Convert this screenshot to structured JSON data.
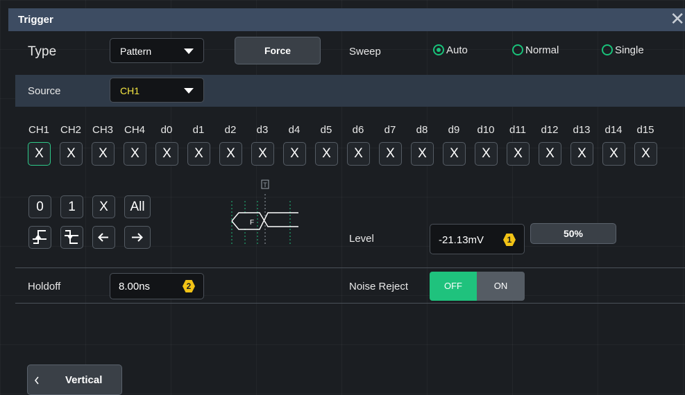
{
  "dialog": {
    "title": "Trigger"
  },
  "type": {
    "label": "Type",
    "value": "Pattern"
  },
  "force_label": "Force",
  "sweep": {
    "label": "Sweep",
    "options": [
      "Auto",
      "Normal",
      "Single"
    ],
    "selected": "Auto"
  },
  "source": {
    "label": "Source",
    "value": "CH1"
  },
  "channels": {
    "labels": [
      "CH1",
      "CH2",
      "CH3",
      "CH4",
      "d0",
      "d1",
      "d2",
      "d3",
      "d4",
      "d5",
      "d6",
      "d7",
      "d8",
      "d9",
      "d10",
      "d11",
      "d12",
      "d13",
      "d14",
      "d15"
    ],
    "values": [
      "X",
      "X",
      "X",
      "X",
      "X",
      "X",
      "X",
      "X",
      "X",
      "X",
      "X",
      "X",
      "X",
      "X",
      "X",
      "X",
      "X",
      "X",
      "X",
      "X"
    ],
    "selected": "CH1"
  },
  "pattern_buttons": [
    "0",
    "1",
    "X",
    "All"
  ],
  "edge_buttons": [
    "rising-edge-icon",
    "falling-edge-icon",
    "arrow-left-icon",
    "arrow-right-icon"
  ],
  "diagram": {
    "marker_f": "F",
    "marker_t": "T"
  },
  "level": {
    "label": "Level",
    "value": "-21.13mV",
    "badge": "1",
    "preset": "50%"
  },
  "holdoff": {
    "label": "Holdoff",
    "value": "8.00ns",
    "badge": "2"
  },
  "noise_reject": {
    "label": "Noise Reject",
    "off": "OFF",
    "on": "ON",
    "state": "OFF"
  },
  "vertical_button": {
    "label": "Vertical"
  },
  "colors": {
    "accent": "#1fc27d",
    "badge": "#f2c316",
    "source_text": "#f5e642",
    "titlebar": "#3d4c62"
  }
}
